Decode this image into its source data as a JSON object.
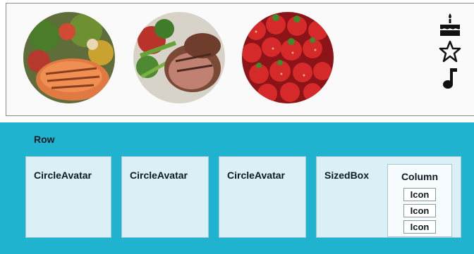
{
  "preview": {
    "avatars": [
      {
        "subject": "grilled salmon salad"
      },
      {
        "subject": "seared steak with vegetables"
      },
      {
        "subject": "strawberries"
      }
    ],
    "icons": [
      "cake-icon",
      "star-outline-icon",
      "music-note-icon"
    ]
  },
  "diagram": {
    "row_label": "Row",
    "boxes": [
      {
        "label": "CircleAvatar"
      },
      {
        "label": "CircleAvatar"
      },
      {
        "label": "CircleAvatar"
      }
    ],
    "sized_box": {
      "label": "SizedBox",
      "column": {
        "label": "Column",
        "icons": [
          "Icon",
          "Icon",
          "Icon"
        ]
      }
    },
    "colors": {
      "background": "#1fb3cf",
      "box": "#daf0f6"
    }
  }
}
